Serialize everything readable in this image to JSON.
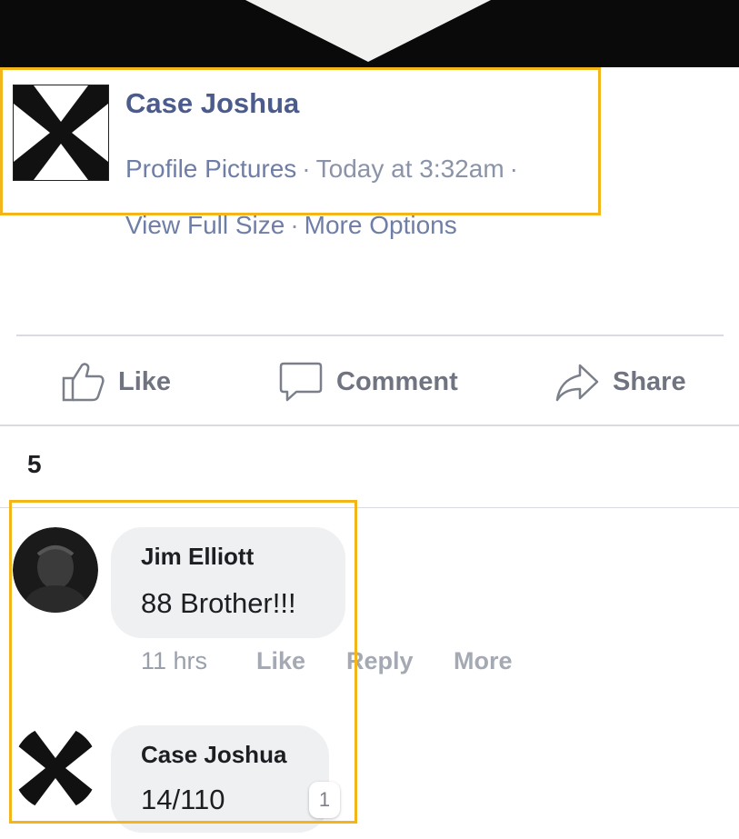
{
  "post": {
    "author": "Case Joshua",
    "album": "Profile Pictures",
    "separator": "·",
    "timestamp": "Today at 3:32am",
    "view_full_size": "View Full Size",
    "more_options": "More Options"
  },
  "actions": {
    "like": "Like",
    "comment": "Comment",
    "share": "Share"
  },
  "comments_count": "5",
  "comments": [
    {
      "author": "Jim Elliott",
      "text": "88 Brother!!!",
      "time": "11 hrs",
      "like": "Like",
      "reply": "Reply",
      "more": "More"
    },
    {
      "author": "Case Joshua",
      "text": "14/110",
      "reactions": "1"
    }
  ],
  "colors": {
    "link_blue": "#4b5b8c",
    "meta_gray": "#8b93a8",
    "highlight": "#f3b519",
    "bubble_bg": "#eff0f2"
  },
  "icons": [
    "thumbs-up-icon",
    "comment-bubble-icon",
    "share-arrow-icon",
    "x-cross-avatar-icon"
  ]
}
